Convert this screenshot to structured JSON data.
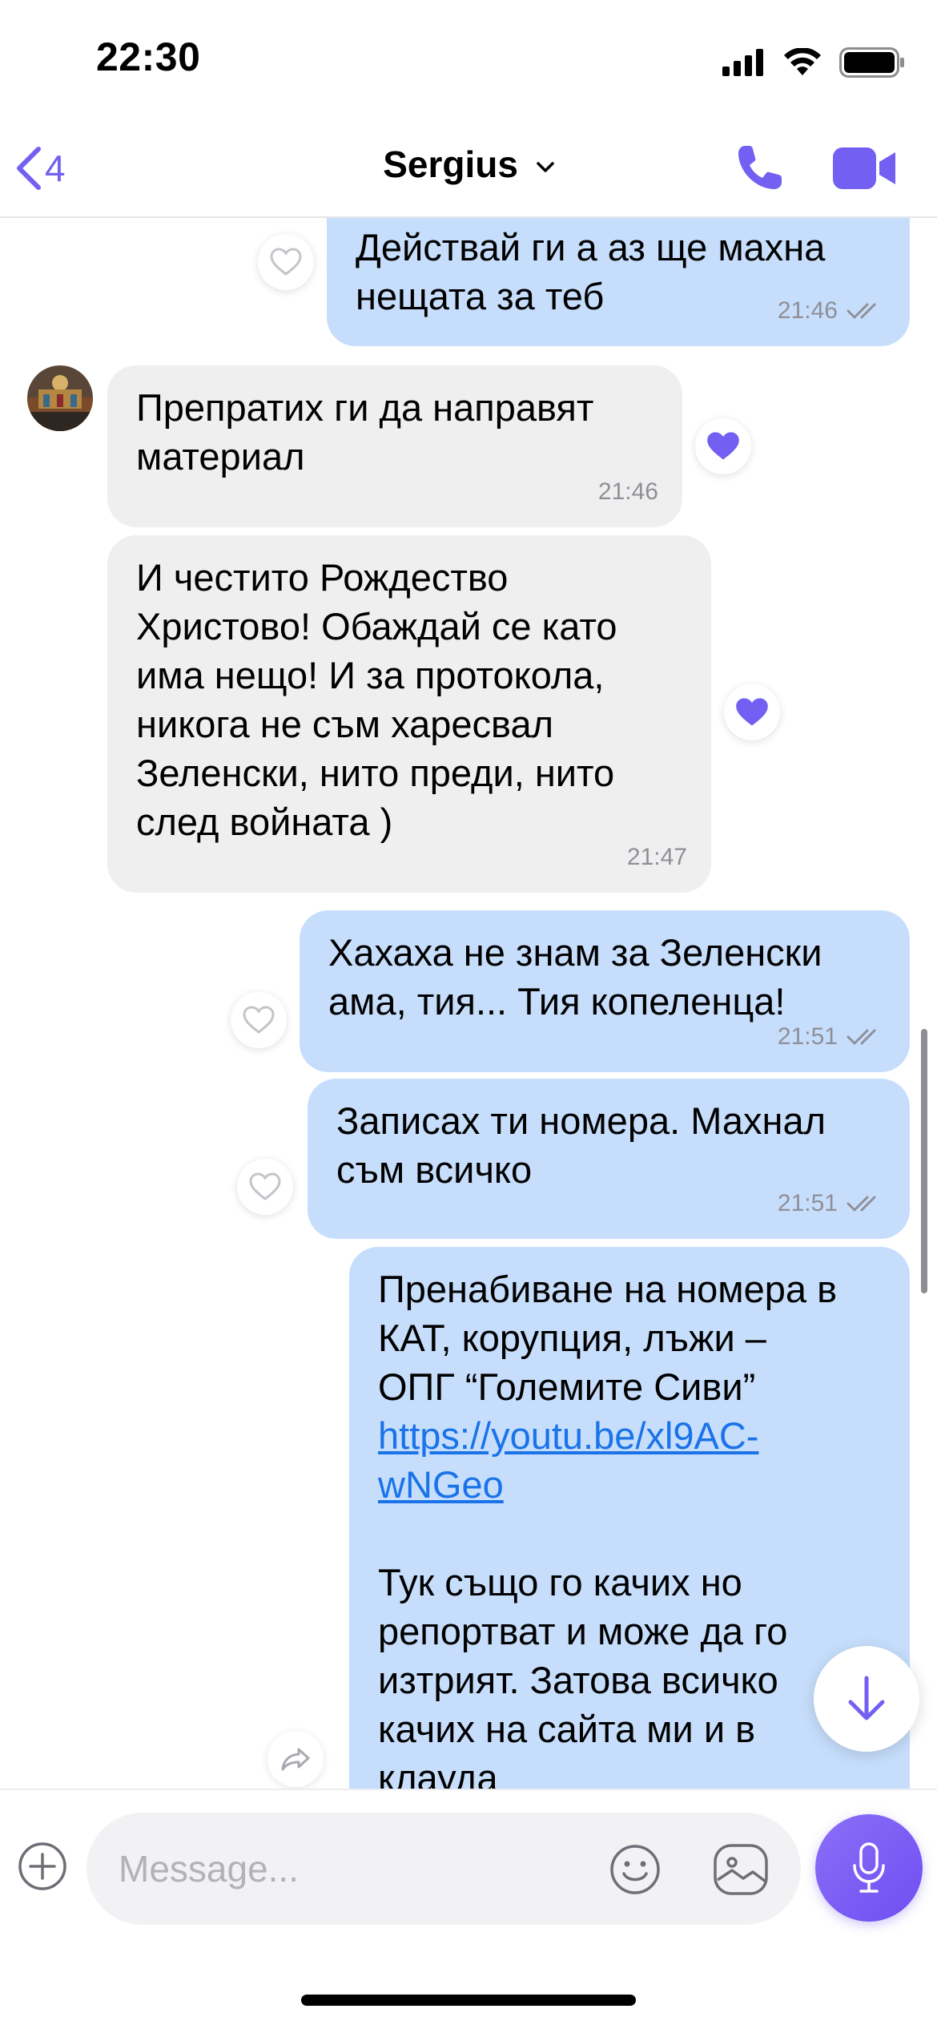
{
  "status_bar": {
    "time": "22:30"
  },
  "nav": {
    "back_count": "4",
    "contact_name": "Sergius"
  },
  "messages": [
    {
      "direction": "out",
      "text": "Действай ги а аз ще махна\nнещата за теб",
      "time": "21:46",
      "liked": false
    },
    {
      "direction": "in",
      "text": "Препратих ги да направят\nматериал",
      "time": "21:46",
      "liked": true
    },
    {
      "direction": "in",
      "text": "И честито Рождество\nХристово! Обаждай се като\nима нещо! И за протокола,\nникога не съм харесвал\nЗеленски, нито преди, нито\nслед войната )",
      "time": "21:47",
      "liked": true
    },
    {
      "direction": "out",
      "text": "Хахаха не знам за Зеленски\nама, тия... Тия копеленца!",
      "time": "21:51",
      "liked": false
    },
    {
      "direction": "out",
      "text": "Записах ти номера. Махнал\nсъм всичко",
      "time": "21:51",
      "liked": false
    },
    {
      "direction": "out",
      "text_before_link": "Пренабиване на номера в\nКАТ, корупция, лъжи –\nОПГ “Големите Сиви”",
      "link": "https://youtu.be/xl9AC-\nwNGeo",
      "text_after_link": "Тук също го качих но\nрепортват и може да го\nизтрият. Затова всичко\nкачих на сайта ми и в\nклауда"
    }
  ],
  "composer": {
    "placeholder": "Message..."
  },
  "colors": {
    "accent": "#7360f2",
    "outgoing_bubble": "#c6defc",
    "incoming_bubble": "#efefef",
    "link": "#1a73e8"
  },
  "icons": [
    "back-chevron-icon",
    "chevron-down-icon",
    "phone-icon",
    "video-camera-icon",
    "heart-icon",
    "filled-heart-icon",
    "double-check-icon",
    "arrow-down-icon",
    "forward-icon",
    "plus-icon",
    "emoji-icon",
    "gallery-icon",
    "microphone-icon"
  ]
}
